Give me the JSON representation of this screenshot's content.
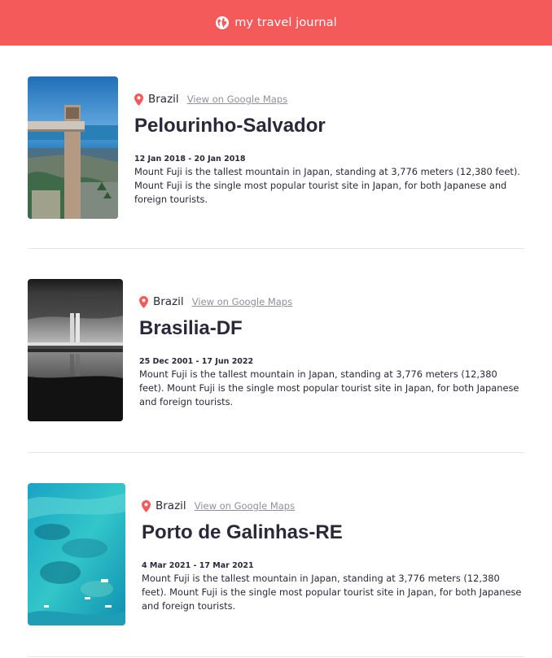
{
  "header": {
    "title": "my travel journal",
    "icon": "globe-icon",
    "background": "#f55a5a"
  },
  "entries": [
    {
      "country": "Brazil",
      "maps_label": "View on Google Maps",
      "place": "Pelourinho-Salvador",
      "dates": "12 Jan 2018 - 20 Jan 2018",
      "description": "Mount Fuji is the tallest mountain in Japan, standing at 3,776 meters (12,380 feet). Mount Fuji is the single most popular tourist site in Japan, for both Japanese and foreign tourists."
    },
    {
      "country": "Brazil",
      "maps_label": "View on Google Maps",
      "place": "Brasilia-DF",
      "dates": "25 Dec 2001 - 17 Jun 2022",
      "description": "Mount Fuji is the tallest mountain in Japan, standing at 3,776 meters (12,380 feet). Mount Fuji is the single most popular tourist site in Japan, for both Japanese and foreign tourists."
    },
    {
      "country": "Brazil",
      "maps_label": "View on Google Maps",
      "place": "Porto de Galinhas-RE",
      "dates": "4 Mar 2021 - 17 Mar 2021",
      "description": "Mount Fuji is the tallest mountain in Japan, standing at 3,776 meters (12,380 feet). Mount Fuji is the single most popular tourist site in Japan, for both Japanese and foreign tourists."
    }
  ],
  "colors": {
    "accent": "#f55a5a",
    "text": "#2b283a",
    "link": "#918e9b"
  }
}
